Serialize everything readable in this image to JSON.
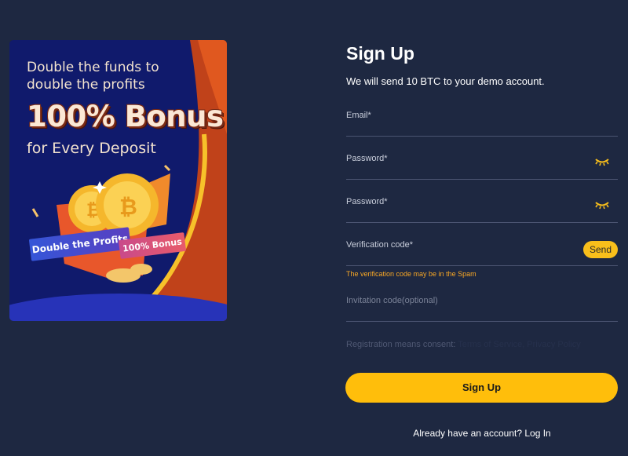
{
  "promo": {
    "headline_line1": "Double the funds to",
    "headline_line2": "double the profits",
    "bonus": "100% Bonus",
    "sub": "for Every Deposit",
    "ribbon_left": "Double the Profits",
    "ribbon_right": "100% Bonus"
  },
  "form": {
    "title": "Sign Up",
    "subtitle": "We will send 10 BTC to your demo account.",
    "email_placeholder": "Email*",
    "password_placeholder": "Password*",
    "confirm_password_placeholder": "Password*",
    "verification_placeholder": "Verification code*",
    "send_label": "Send",
    "spam_hint": "The verification code may be in the Spam",
    "invitation_placeholder": "Invitation code(optional)",
    "consent_text": "Registration means consent:",
    "consent_links": "Terms of Service, Privacy Policy",
    "submit_label": "Sign Up",
    "login_prompt": "Already have an account?",
    "login_link": "Log In"
  },
  "colors": {
    "background": "#1e2841",
    "accent": "#ffbe0b",
    "hint": "#f9a825",
    "promo_bg": "#101a6c"
  },
  "icons": {
    "password_toggle": "eye-closed-icon",
    "confirm_toggle": "eye-closed-icon"
  }
}
